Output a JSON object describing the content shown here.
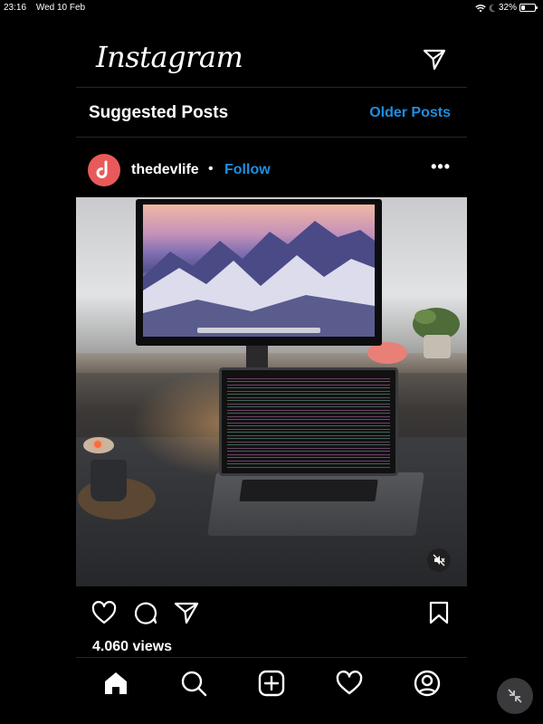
{
  "status_bar": {
    "time": "23:16",
    "date": "Wed 10 Feb",
    "battery_percent": "32%",
    "battery_level": 0.32,
    "icons": [
      "wifi-icon",
      "moon-icon",
      "battery-icon"
    ]
  },
  "header": {
    "logo": "Instagram",
    "dm_icon": "paper-plane-icon"
  },
  "suggested": {
    "title": "Suggested Posts",
    "older_posts_label": "Older Posts"
  },
  "post": {
    "username": "thedevlife",
    "separator": "•",
    "follow_label": "Follow",
    "more_label": "•••",
    "avatar_color": "#e85a5a",
    "media_description": "Desk setup with monitor showing mountains and laptop with code",
    "mute_icon": "speaker-muted-icon",
    "views": "4.060 views",
    "actions": [
      "heart-icon",
      "comment-icon",
      "share-icon",
      "bookmark-icon"
    ]
  },
  "bottom_nav": {
    "items": [
      "home-icon",
      "search-icon",
      "add-post-icon",
      "activity-heart-icon",
      "profile-icon"
    ]
  },
  "colors": {
    "accent": "#1d8fe1",
    "background": "#000000",
    "divider": "#262626"
  }
}
